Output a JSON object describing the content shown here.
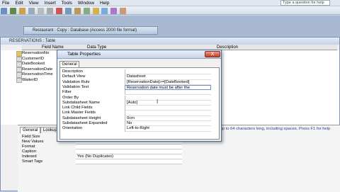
{
  "menu": [
    "File",
    "Edit",
    "View",
    "Insert",
    "Tools",
    "Window",
    "Help"
  ],
  "help_box": "Type a question for help",
  "db_window_title": "Restaurant : Copy : Database (Access 2000 file format)",
  "table_window": {
    "title": "RESERVATIONS : Table",
    "columns": [
      "Field Name",
      "Data Type",
      "Description"
    ],
    "fields": [
      "ReservationNo",
      "CustomerID",
      "DateBooked",
      "ReservationDate",
      "ReservationTime",
      "WaiterID"
    ]
  },
  "field_props": {
    "tabs": [
      "General",
      "Lookup"
    ],
    "rows": [
      {
        "label": "Field Size",
        "value": ""
      },
      {
        "label": "New Values",
        "value": ""
      },
      {
        "label": "Format",
        "value": ""
      },
      {
        "label": "Caption",
        "value": ""
      },
      {
        "label": "Indexed",
        "value": "Yes (No Duplicates)"
      },
      {
        "label": "Smart Tags",
        "value": ""
      }
    ]
  },
  "hint": "A field name can be up to 64 characters long, including spaces. Press F1 for help on field names.",
  "dialog": {
    "title": "Table Properties",
    "tab": "General",
    "close": "X",
    "props": [
      {
        "label": "Description",
        "value": ""
      },
      {
        "label": "Default View",
        "value": "Datasheet"
      },
      {
        "label": "Validation Rule",
        "value": "[ReservationDate]>=[DateBooked]"
      },
      {
        "label": "Validation Text",
        "value": "Reservation date must be after the"
      },
      {
        "label": "Filter",
        "value": ""
      },
      {
        "label": "Order By",
        "value": ""
      },
      {
        "label": "Subdatasheet Name",
        "value": "[Auto]"
      },
      {
        "label": "Link Child Fields",
        "value": ""
      },
      {
        "label": "Link Master Fields",
        "value": ""
      },
      {
        "label": "Subdatasheet Height",
        "value": "0cm"
      },
      {
        "label": "Subdatasheet Expanded",
        "value": "No"
      },
      {
        "label": "Orientation",
        "value": "Left-to-Right"
      }
    ]
  }
}
